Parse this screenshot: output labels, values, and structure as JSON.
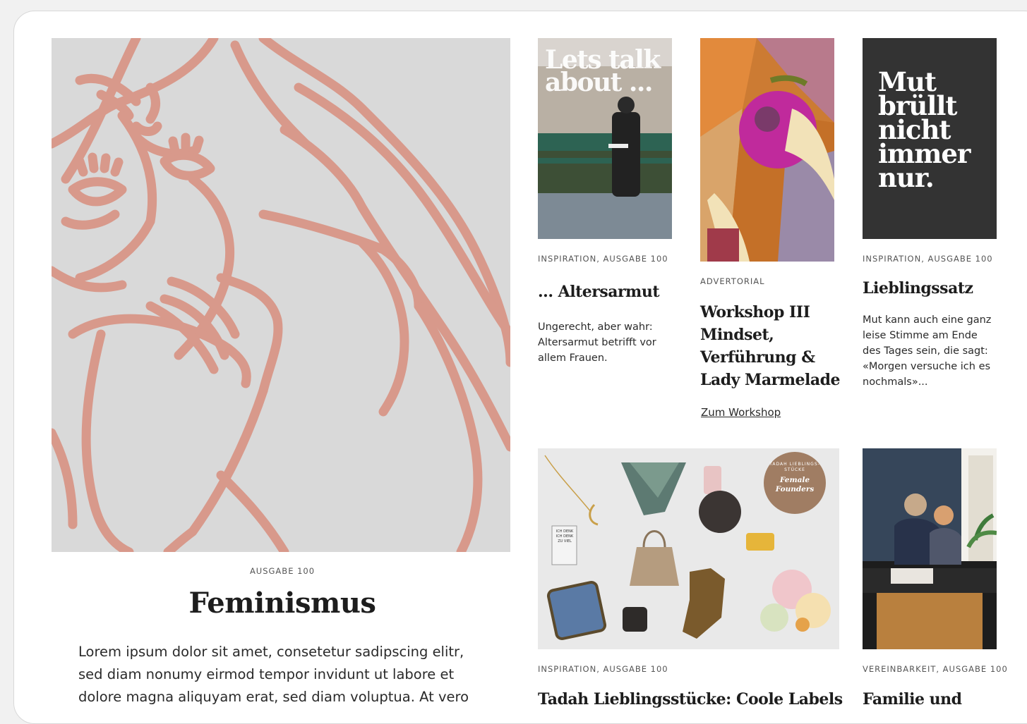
{
  "hero": {
    "kicker": "AUSGABE 100",
    "title": "Feminismus",
    "text": "Lorem ipsum dolor sit amet, consetetur sadipscing elitr, sed diam nonumy eirmod tempor invidunt ut labore et dolore magna aliquyam erat, sed diam voluptua. At vero"
  },
  "articles": [
    {
      "kicker": "INSPIRATION, AUSGABE 100",
      "title": "... Altersarmut",
      "text": "Ungerecht, aber wahr: Altersarmut betrifft vor allem Frauen.",
      "image_overlay": "Lets talk about ..."
    },
    {
      "kicker": "ADVERTORIAL",
      "title": "Workshop III Mindset, Verführung & Lady Marmelade",
      "link": "Zum Workshop"
    },
    {
      "kicker": "INSPIRATION, AUSGABE 100",
      "title": "Lieblingssatz",
      "text": "Mut kann auch eine ganz leise Stimme am Ende des Tages sein, die sagt: «Morgen versuche ich es nochmals»...",
      "image_quote": "Mut brüllt nicht immer nur."
    },
    {
      "kicker": "INSPIRATION, AUSGABE 100",
      "title": "Tadah Lieblingsstücke: Coole Labels",
      "badge_top": "TADAH LIEBLINGS- STÜCKE",
      "badge_main": "Female Founders",
      "sticker": "ICH DENK ICH DENK ZU VIEL"
    },
    {
      "kicker": "VEREINBARKEIT, AUSGABE 100",
      "title": "Familie und"
    }
  ],
  "colors": {
    "hero_bg": "#d9d9d9",
    "hero_line": "#d8998b",
    "quote_bg": "#333333",
    "badge": "#a07d63"
  }
}
